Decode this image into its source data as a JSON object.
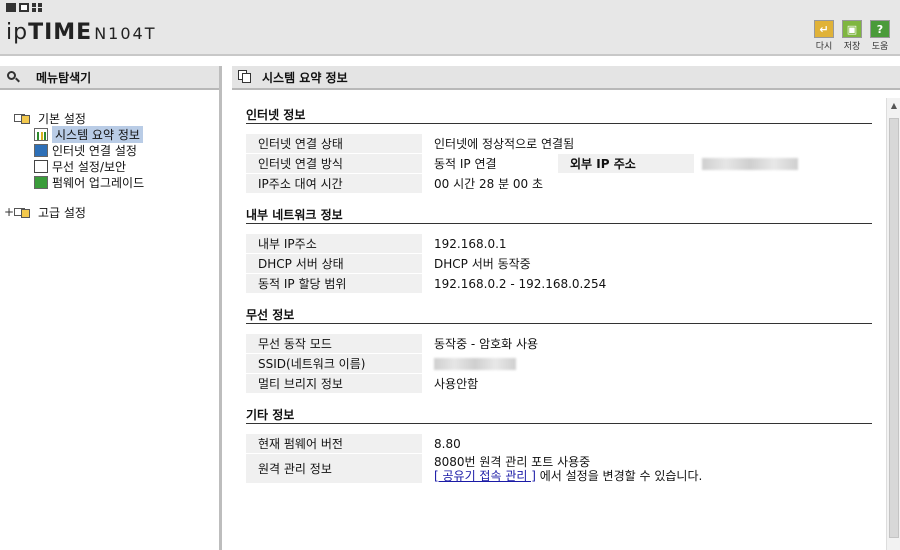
{
  "header": {
    "logo_ip": "ip",
    "logo_time": "TIME",
    "logo_model": "N104T",
    "buttons": [
      {
        "label": "다시",
        "glyph": "↵"
      },
      {
        "label": "저장",
        "glyph": "▣"
      },
      {
        "label": "도움",
        "glyph": "?"
      }
    ]
  },
  "sidebar": {
    "title": "메뉴탐색기",
    "basic": {
      "label": "기본 설정",
      "items": [
        {
          "label": "시스템 요약 정보"
        },
        {
          "label": "인터넷 연결 설정"
        },
        {
          "label": "무선 설정/보안"
        },
        {
          "label": "펌웨어 업그레이드"
        }
      ]
    },
    "advanced": {
      "label": "고급 설정",
      "expander": "+"
    }
  },
  "main": {
    "title": "시스템 요약 정보",
    "internet": {
      "title": "인터넷 정보",
      "status_label": "인터넷 연결 상태",
      "status_value": "인터넷에 정상적으로 연결됨",
      "method_label": "인터넷 연결 방식",
      "method_value": "동적 IP 연결",
      "external_ip_label": "외부 IP 주소",
      "lease_label": "IP주소 대여 시간",
      "lease_value": "00 시간 28 분 00 초"
    },
    "lan": {
      "title": "내부 네트워크 정보",
      "ip_label": "내부 IP주소",
      "ip_value": "192.168.0.1",
      "dhcp_label": "DHCP 서버 상태",
      "dhcp_value": "DHCP 서버 동작중",
      "range_label": "동적 IP 할당 범위",
      "range_value": "192.168.0.2 - 192.168.0.254"
    },
    "wireless": {
      "title": "무선 정보",
      "mode_label": "무선 동작 모드",
      "mode_value": "동작중 - 암호화 사용",
      "ssid_label": "SSID(네트워크 이름)",
      "bridge_label": "멀티 브리지 정보",
      "bridge_value": "사용안함"
    },
    "other": {
      "title": "기타 정보",
      "fw_label": "현재 펌웨어 버전",
      "fw_value": "8.80",
      "remote_label": "원격 관리 정보",
      "remote_line1": "8080번 원격 관리 포트 사용중",
      "remote_link": "[ 공유기 접속 관리 ]",
      "remote_line2_suffix": " 에서 설정을 변경할 수 있습니다."
    }
  }
}
